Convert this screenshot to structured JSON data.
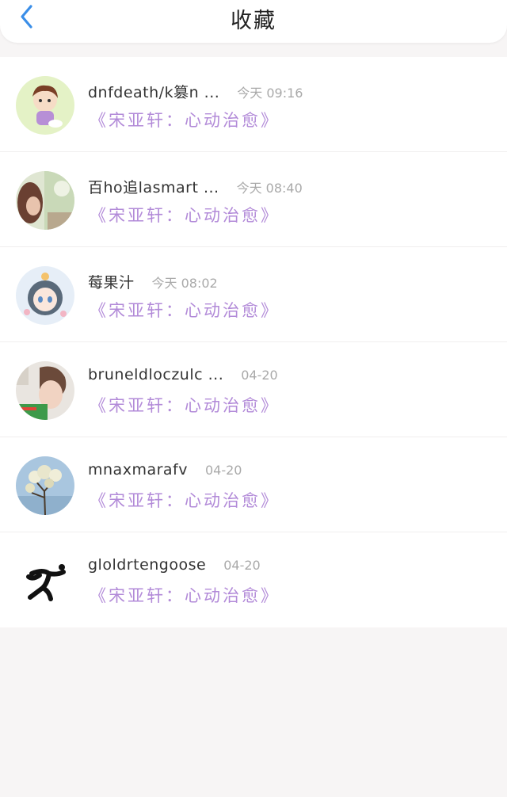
{
  "header": {
    "title": "收藏"
  },
  "colors": {
    "back_arrow": "#3a8ee8",
    "tag_text": "#b28ad8",
    "time_text": "#a9a9a9"
  },
  "items": [
    {
      "name": "dnfdeath/k篡n ...",
      "time": "今天 09:16",
      "tag": "《宋亚轩：心动治愈》",
      "avatar": "cartoon-boy-avatar"
    },
    {
      "name": "百ho追lasmart ...",
      "time": "今天 08:40",
      "tag": "《宋亚轩：心动治愈》",
      "avatar": "photo-girl-avatar"
    },
    {
      "name": "莓果汁",
      "time": "今天 08:02",
      "tag": "《宋亚轩：心动治愈》",
      "avatar": "anime-girl-avatar"
    },
    {
      "name": "bruneldloczulc ...",
      "time": "04-20",
      "tag": "《宋亚轩：心动治愈》",
      "avatar": "boy-selfie-avatar"
    },
    {
      "name": "mnaxmarafv",
      "time": "04-20",
      "tag": "《宋亚轩：心动治愈》",
      "avatar": "blossom-tree-avatar"
    },
    {
      "name": "gloldrtengoose",
      "time": "04-20",
      "tag": "《宋亚轩：心动治愈》",
      "avatar": "running-figure-avatar"
    }
  ]
}
